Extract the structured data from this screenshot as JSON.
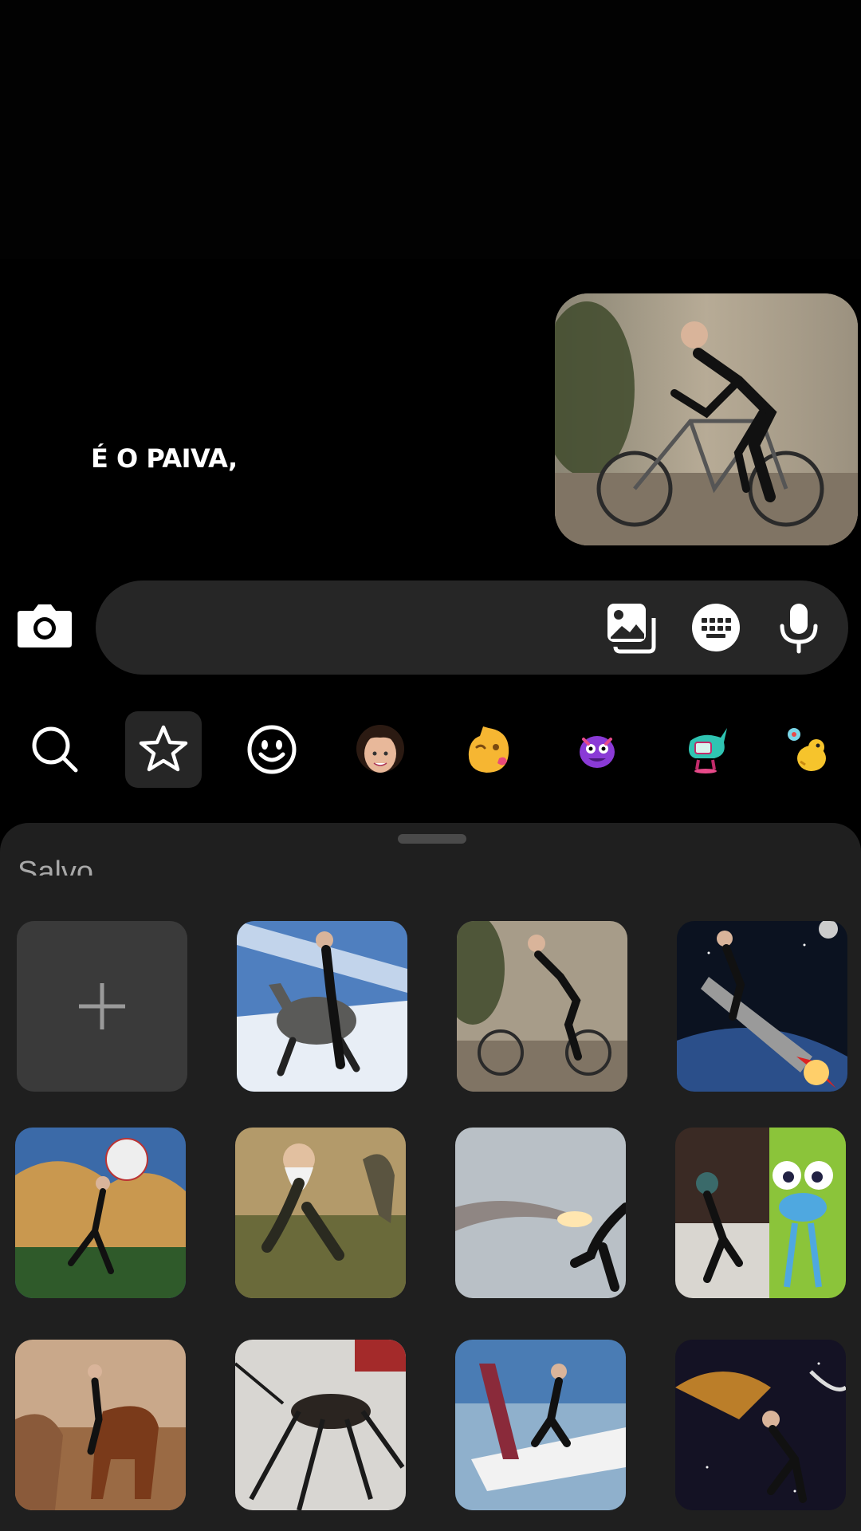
{
  "chat": {
    "caption": "É O PAIVA,",
    "sent_sticker": "stick-figure-riding-bicycle-sticker"
  },
  "composer": {
    "icons": [
      "camera-icon",
      "gallery-icon",
      "keyboard-icon",
      "microphone-icon"
    ]
  },
  "sticker_tabs": [
    {
      "icon": "search-icon",
      "active": false
    },
    {
      "icon": "star-icon",
      "active": true
    },
    {
      "icon": "smiley-icon",
      "active": false
    },
    {
      "icon": "avatar-face-icon",
      "active": false
    },
    {
      "icon": "kissing-face-sticker-icon",
      "active": false
    },
    {
      "icon": "purple-monster-sticker-icon",
      "active": false
    },
    {
      "icon": "teal-creature-sticker-icon",
      "active": false
    },
    {
      "icon": "yellow-bird-sticker-icon",
      "active": false
    }
  ],
  "tray": {
    "section_label": "Salvo",
    "add_button": "plus-icon",
    "stickers": [
      "stick-figure-riding-donkey-in-sky",
      "stick-figure-riding-bicycle",
      "stick-figure-riding-rocket-in-space",
      "stick-figure-holding-baseball-at-stadium",
      "bearded-stick-figure-with-dinosaurs",
      "stick-figure-with-rocket-exhaust",
      "stick-figure-with-cartoon-insect",
      "stick-figure-on-horse-painting",
      "stick-figure-mosquito",
      "stick-figure-on-airplane",
      "stick-figure-in-galaxy"
    ]
  }
}
